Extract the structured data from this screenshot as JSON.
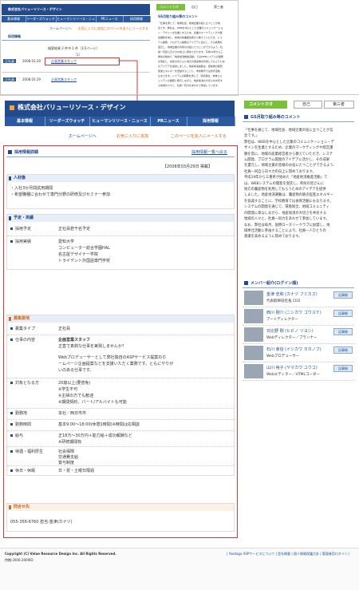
{
  "thumb": {
    "company": "株式会社バリューリソース・デザイン",
    "nav": [
      "基本情報",
      "リーダーズウォッチ",
      "ヒューマンリソース・ニュース",
      "PRニュース",
      "採用情報"
    ],
    "links": [
      "ホームページへ",
      "お気に入りに追加",
      "このページを友人にメールする"
    ],
    "section": "採用情報",
    "count_line": "検索結果 2 件中 1 件（1/1ページ）",
    "pager": "［1］",
    "items": [
      {
        "badge": "正社員",
        "date": "2008.03.29",
        "title": "企画営業スタッフ"
      },
      {
        "badge": "正社員",
        "date": "2008.03.29",
        "title": "企画営業スタッフ"
      }
    ],
    "side_btns": [
      "コメントカタ",
      "自己",
      "第三者"
    ],
    "side_title": "GS月取り組み等のコメント",
    "side_text": [
      "「仕事を通じて、地域社会、地域企業の役に立つことが信",
      "念です。弊社は、WEBを中心とした企業のコミュニケーショ",
      "ン・デザインを生業とするため、企業のマーケティングや経",
      "営課題を常に、地域の産業経営者から教えていただき、シス",
      "テム開発、プログラム開発のアイデアに活かし、その成果を",
      "還元し、地域企業の皆様のお役にたつことができるよう、社",
      "員一同自ら日々力の向上に努めております。平成19年から三",
      "重県が始めた「地産地消推進活動」ではWEBシステムの開発",
      "を受託し、県民の皆さんに地元の農産物を利用してもらうため",
      "のアイデアを提供しました。地産地消運動は、農産物の販売",
      "促進エネルギーを低減することに、学校教育では食育活動",
      "もなります。システムの開発を通じて、環境保全、地域コミ",
      "ュニティの開発に寄与しながら、地産地消の大切さを共有す",
      "る地域の人々と、社員一同力をあわせて参加しています。"
    ]
  },
  "main": {
    "company": "株式会社バリューリソース・デザイン",
    "nav": [
      "基本情報",
      "リーダーズウォッチ",
      "ヒューマンリソース・ニュース",
      "PRニュース",
      "採用情報"
    ],
    "links": [
      "ホームページへ",
      "お気に入りに追加",
      "このページを友人にメールする"
    ],
    "section": "採用情報詳細",
    "back_link": "採用情報一覧へ戻る",
    "date": "【2008年03月29日 掲載】",
    "jinzaizo_title": "人材像",
    "jinzaizo_lines": [
      "・入社3か月間試用期間",
      "・希望職種に合わせて専門分野の研修及びセミナー参加"
    ],
    "yotei_title": "予定・実績",
    "yotei_rows": [
      {
        "label": "採用予定",
        "values": [
          "正社員若干名予定"
        ]
      },
      {
        "label": "採用実績",
        "values": [
          "愛知大学",
          "コンピューター総合学園HAL",
          "名古屋デザイナー学院",
          "トライデント外国語専門学校"
        ]
      }
    ],
    "boshu_title": "募集要項",
    "boshu_rows": [
      {
        "label": "募集タイプ",
        "values": [
          "正社員"
        ]
      },
      {
        "label": "仕事の内容",
        "values": [
          "企画営業スタッフ",
          "正直で真剣な仕事を実現しませんか？",
          "",
          "Webプロデューサーとして弊社独自のASPサービス提案のホ",
          "ームページ企画提案などを支援いただく業務です。ともにやりが",
          "いのある仕事です。"
        ]
      },
      {
        "label": "対象となる方",
        "values": [
          "20歳以上(要普免)",
          "※学生不可",
          "※主婦の方でも歓迎",
          "※期間契約、パート/アルバイトも可能"
        ]
      },
      {
        "label": "勤務地",
        "values": [
          "本社／西日市市"
        ]
      },
      {
        "label": "勤務時間",
        "values": [
          "基本9:00～18:00(休憩1時間)※時間は応相談"
        ]
      },
      {
        "label": "給与",
        "values": [
          "正18万～30万円＋能力給＋成功報酬など",
          "※研修期間有"
        ]
      },
      {
        "label": "待遇・福利厚生",
        "values": [
          "社会保険",
          "交通費支給",
          "賞与制度"
        ]
      },
      {
        "label": "休日・休暇",
        "values": [
          "日・祝・土曜日隔週"
        ]
      }
    ],
    "contact_title": "問合せ先",
    "contact_value": "055-356-6760 担当:金津(カナヅ)"
  },
  "side": {
    "btn_comment": "コメントカタ",
    "tab_self": "自己",
    "tab_third": "第三者",
    "comment_title": "GS月取り組み等のコメント",
    "comment_lines": [
      "「仕事を通じて、地域社会、地域企業の役に立つことが信",
      "念です。」",
      "弊社は、WEBを中心とした企業のコミュニケーション・デ",
      "ザインを生業とするため、企業のマーケティングや経営課",
      "題を常に、地域の産業経営者から教えていただき、システ",
      "ム開発、プログラム開発のアイデアに活かし、その成果",
      "を還元し、地域企業の皆様のお役にたつことができるよう、",
      "社員一同自ら日々力の向上に努めております。",
      "平成19年から三重県が始めた「地産地消推進活動」で",
      "は、WEBシステムの開発を受託し、県民の皆さんに",
      "地元の農産物を利用してもらうためのアイデアを提供",
      "しました。地産地消運動は、農産物の販売促進エネルギー",
      "を低減することに、学校教育では食育活動にもなります。",
      "システムの開発を通じて、環境保全、地域コミュニティ",
      "の開発に寄与しながら、地産地消の大切さを共有する",
      "地域の人々と、社員一同力をあわせて参加しています。",
      "なお、弊社は毎月、国際ロータリークラブに加盟し、地",
      "域奉仕活動に参画することにより、社員一人ひとりの",
      "意識を高めるように努めております。"
    ],
    "members_title": "メンバー紹介(ログイン順)",
    "members": [
      {
        "name": "金津 史和 (カナヅ フミカズ)",
        "role": "代表取締役社長 CEO",
        "btn": "記事帳"
      },
      {
        "name": "西川 剛介 (ニシカワ ゴウスケ)",
        "role": "アートディレクター",
        "btn": "記事帳"
      },
      {
        "name": "日比野 剛 (ヒビノ ツヨシ)",
        "role": "Webディレクター／プランナー",
        "btn": "記事帳"
      },
      {
        "name": "石川 孝信 (イシカワ タカノブ)",
        "role": "Webプロデューサー",
        "btn": "記事帳"
      },
      {
        "name": "山川 裕子 (ヤマカワ ユウコ)",
        "role": "Webエディター／HTMLコーダー",
        "btn": "記事帳"
      }
    ]
  },
  "footer": {
    "copyright": "Copyright (C) Value Resource Design Inc. All Rights Reserved.",
    "id": "特徴:2006-2009ID",
    "links": "| Yaodogo ASPサービスについて | 会社概要 | 個人情報保護方針 | 管理者用ログイン |"
  }
}
